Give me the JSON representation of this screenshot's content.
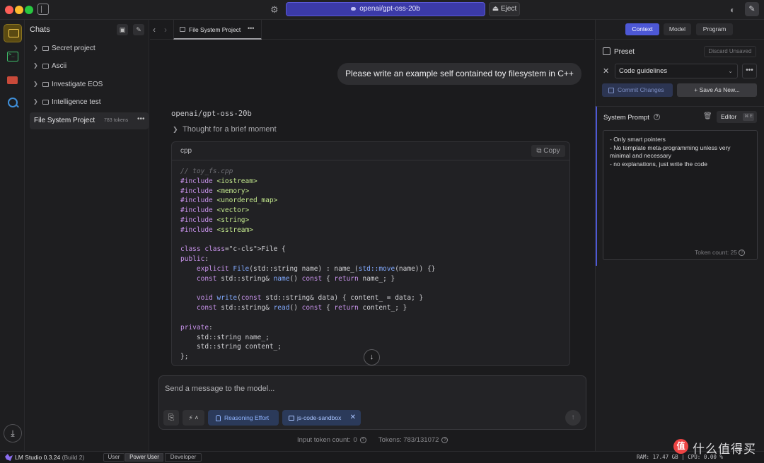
{
  "titlebar": {
    "model_selector": "openai/gpt-oss-20b",
    "eject_label": "⏏ Eject"
  },
  "sidebar": {
    "title": "Chats",
    "folders": [
      {
        "label": "Secret project"
      },
      {
        "label": "Ascii"
      },
      {
        "label": "Investigate EOS"
      },
      {
        "label": "Intelligence test"
      }
    ],
    "active_chat": {
      "label": "File System Project",
      "tokens": "783 tokens"
    }
  },
  "tabs": [
    {
      "label": "File System Project"
    }
  ],
  "conversation": {
    "user_message": "Please write an example self contained toy filesystem in C++",
    "assistant_model": "openai/gpt-oss-20b",
    "thought_label": "Thought for a brief moment",
    "code_block": {
      "language": "cpp",
      "copy_label": "Copy",
      "lines": [
        "// toy_fs.cpp",
        "#include <iostream>",
        "#include <memory>",
        "#include <unordered_map>",
        "#include <vector>",
        "#include <string>",
        "#include <sstream>",
        "",
        "class File {",
        "public:",
        "    explicit File(std::string name) : name_(std::move(name)) {}",
        "    const std::string& name() const { return name_; }",
        "",
        "    void write(const std::string& data) { content_ = data; }",
        "    const std::string& read() const { return content_; }",
        "",
        "private:",
        "    std::string name_;",
        "    std::string content_;",
        "};"
      ]
    }
  },
  "composer": {
    "placeholder": "Send a message to the model...",
    "reasoning_label": "Reasoning Effort",
    "sandbox_label": "js-code-sandbox"
  },
  "token_info": {
    "input_label": "Input token count:",
    "input_value": "0",
    "tokens_label": "Tokens: 783/131072"
  },
  "right_panel": {
    "tabs": [
      "Context",
      "Model",
      "Program"
    ],
    "active_tab": "Context",
    "preset_label": "Preset",
    "discard_label": "Discard Unsaved",
    "preset_value": "Code guidelines",
    "commit_label": "Commit Changes",
    "save_as_label": "+ Save As New...",
    "system_prompt_title": "System Prompt",
    "editor_label": "Editor",
    "editor_shortcut": "⌘ E",
    "system_prompt_text": "- Only smart pointers\n- No template meta-programming unless very minimal and necessary\n- no explanations, just write the code",
    "token_count": "Token count: 25"
  },
  "statusbar": {
    "app_name": "LM Studio 0.3.24",
    "build": "(Build 2)",
    "modes": [
      "User",
      "Power User",
      "Developer"
    ],
    "active_mode": "Power User",
    "stats": "RAM: 17.47 GB  |  CPU: 0.00 %"
  },
  "watermark": {
    "text": "什么值得买",
    "badge": "值"
  },
  "colors": {
    "accent": "#4d58d6",
    "model_selector_bg": "#3b3aa8",
    "chip_bg": "#2b3a5a"
  }
}
